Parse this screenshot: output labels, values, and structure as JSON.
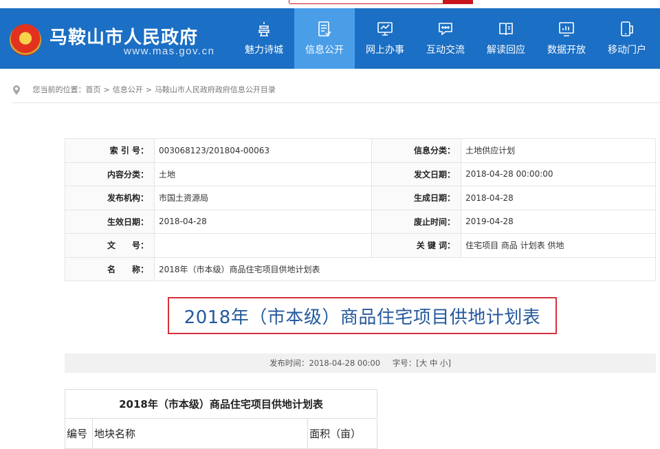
{
  "header": {
    "site_title": "马鞍山市人民政府",
    "site_url": "www.mas.gov.cn",
    "emblem_icon": "national-emblem-icon",
    "nav": [
      {
        "label": "魅力诗城",
        "icon": "pagoda-icon",
        "active": false
      },
      {
        "label": "信息公开",
        "icon": "document-icon",
        "active": true
      },
      {
        "label": "网上办事",
        "icon": "monitor-icon",
        "active": false
      },
      {
        "label": "互动交流",
        "icon": "chat-bubble-icon",
        "active": false
      },
      {
        "label": "解读回应",
        "icon": "open-book-icon",
        "active": false
      },
      {
        "label": "数据开放",
        "icon": "chart-screen-icon",
        "active": false
      },
      {
        "label": "移动门户",
        "icon": "mobile-icon",
        "active": false
      }
    ],
    "colors": {
      "bar": "#1b6fc4",
      "active": "#4a9ee8"
    }
  },
  "breadcrumb": {
    "prefix": "您当前的位置：",
    "items": [
      "首页",
      "信息公开",
      "马鞍山市人民政府政府信息公开目录"
    ],
    "separator": ">"
  },
  "meta": {
    "rows": [
      {
        "k1": "索 引 号：",
        "v1": "003068123/201804-00063",
        "k2": "信息分类：",
        "v2": "土地供应计划"
      },
      {
        "k1": "内容分类：",
        "v1": "土地",
        "k2": "发文日期：",
        "v2": "2018-04-28 00:00:00"
      },
      {
        "k1": "发布机构：",
        "v1": "市国土资源局",
        "k2": "生成日期：",
        "v2": "2018-04-28"
      },
      {
        "k1": "生效日期：",
        "v1": "2018-04-28",
        "k2": "废止时间：",
        "v2": "2019-04-28"
      },
      {
        "k1": "文　　号：",
        "v1": "",
        "k2": "关 键 词：",
        "v2": "住宅项目 商品 计划表 供地"
      }
    ],
    "name_key": "名　　称：",
    "name_value": "2018年（市本级）商品住宅项目供地计划表"
  },
  "doc_title": "2018年（市本级）商品住宅项目供地计划表",
  "publish": {
    "time_label": "发布时间：",
    "time_value": "2018-04-28 00:00",
    "font_label": "字号：[",
    "font_large": "大",
    "font_medium": "中",
    "font_small": "小",
    "font_close": "]"
  },
  "content_table": {
    "caption": "2018年（市本级）商品住宅项目供地计划表",
    "columns": [
      "编号",
      "地块名称",
      "面积（亩）"
    ]
  },
  "colors": {
    "title_text": "#25599c",
    "title_border": "#d6303a"
  }
}
